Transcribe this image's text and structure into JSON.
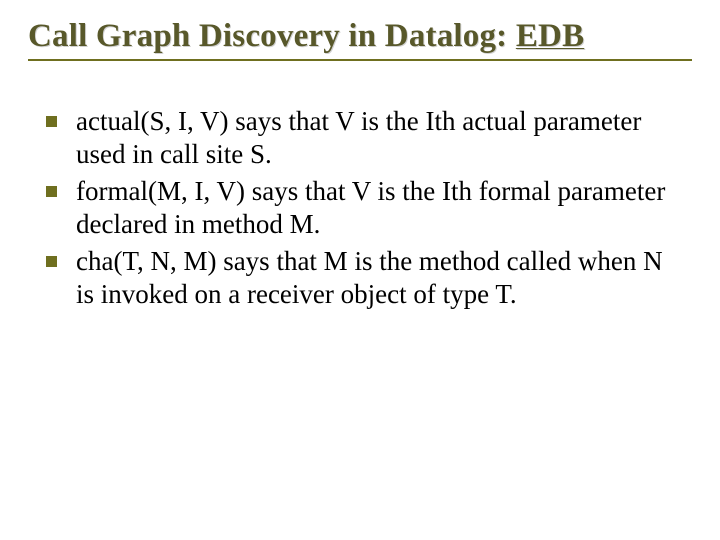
{
  "title": {
    "seg1": "Call Graph Discovery in Datalog: ",
    "seg2_u": "EDB"
  },
  "bullets": [
    {
      "seg1": "actual",
      "seg2": "(S, I, V) says that V is the Ith actual parameter used in call site S."
    },
    {
      "seg1": "formal",
      "seg2": "(M, I, V) says that V is the Ith formal parameter declared in method M."
    },
    {
      "seg1": "cha",
      "seg2": "(T, N, M) says that M is the method called when N is invoked on a receiver object of type T."
    }
  ]
}
